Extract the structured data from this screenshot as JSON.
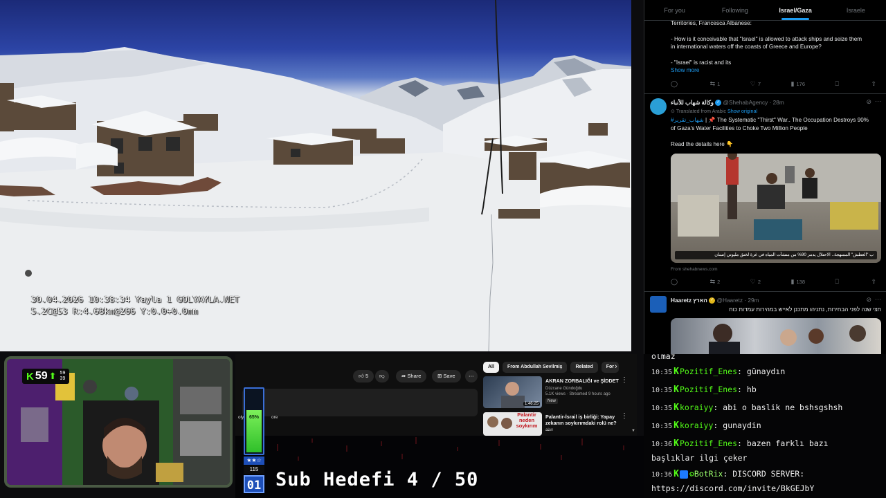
{
  "camera": {
    "osd_line1": "30.04.2026 10:38:34 Yayla 1 GOLYAYLA.NET",
    "osd_line2": "5.2C@53 R:4.68km@266 Y:0.0+0.0mm"
  },
  "twitter": {
    "tabs": [
      "For you",
      "Following",
      "Israel/Gaza",
      "Israele"
    ],
    "active_tab": "Israel/Gaza",
    "post1": {
      "lines": [
        "Territories, Francesca Albanese:",
        "",
        "- How is it conceivable that \"Israel\" is allowed to attack ships and seize them",
        "in international waters off the coasts of Greece and Europe?",
        "",
        "- \"Israel\" is racist and its"
      ],
      "show_more": "Show more",
      "replies": "",
      "reposts": "1",
      "likes": "7",
      "views": "176"
    },
    "post2": {
      "name": "وكالة شهاب للأنباء",
      "handle": "@ShehabAgency",
      "time": "28m",
      "translated": "Translated from Arabic",
      "show_original": "Show original",
      "hashtag": "#شهاب_تقرير",
      "text_after_hashtag": "| 📌 The Systematic \"Thirst\" War.. The Occupation Destroys 90%",
      "text_line2": "of Gaza's Water Facilities to Choke Two Million People",
      "details": "Read the details here 👇",
      "image_caption": "ب \"العطش\" الممنهجة.. الاحتلال يدمر 90% من منشآت المياه في غزة لخنق مليوني إنسان",
      "link_source": "From shehabnews.com",
      "replies": "",
      "reposts": "2",
      "likes": "2",
      "views": "138"
    },
    "post3": {
      "name": "Haaretz הארץ",
      "handle": "@Haaretz",
      "time": "29m",
      "text": "חצי שנה לפני הבחירות, נתניהו מתכנן לאייש במהירות עמדות כוח"
    }
  },
  "chat": {
    "partial_top": "olmaz",
    "messages": [
      {
        "time": "10:35",
        "user": "Pozitif_Enes",
        "text": "günaydın"
      },
      {
        "time": "10:35",
        "user": "Pozitif_Enes",
        "text": "hb"
      },
      {
        "time": "10:35",
        "user": "koraiyy",
        "text": "abi o baslik ne bshsgshsh"
      },
      {
        "time": "10:35",
        "user": "koraiyy",
        "text": "gunaydin"
      },
      {
        "time": "10:36",
        "user": "Pozitif_Enes",
        "text": "bazen farklı bazı"
      },
      {
        "time": "",
        "user": "",
        "text": "başlıklar ilgi çeker"
      },
      {
        "time": "10:36",
        "user": "BotRix",
        "text": "DISCORD SERVER:"
      },
      {
        "time": "",
        "user": "",
        "text": "https://discord.com/invite/BkGEJbY"
      }
    ]
  },
  "youtube": {
    "like_count": "5",
    "share_label": "Share",
    "save_label": "Save",
    "desc_fragment_left": "olya",
    "desc_fragment_more": "ore",
    "chips": [
      "All",
      "From Abdullah Sevilmiş",
      "Related",
      "For"
    ],
    "recs": [
      {
        "title": "AKRAN ZORBALIĞI ve ŞİDDET",
        "channel": "Düzcane Gündoğdu",
        "meta": "5.1K views · Streamed 9 hours ago",
        "badge": "New",
        "duration": "1:46:25"
      },
      {
        "title": "Palantir-İsrail iş birliği: Yapay zekanın soykırımdaki rolü ne? ...",
        "channel": "alan",
        "meta": "",
        "badge": "",
        "duration": "",
        "thumb_text": "Palantir neden soykırım"
      }
    ]
  },
  "stream": {
    "kick_count": "59",
    "side_top": "59",
    "side_bottom": "39",
    "level_percent_label": "65%",
    "level_percent": 65,
    "level_stars": "★★☆",
    "level_points": "115",
    "level_number": "01",
    "sub_goal": "Sub Hedefi 4 / 50"
  },
  "colors": {
    "kick_green": "#53fc18",
    "twitter_blue": "#1d9bf0",
    "level_blue": "#1e4fb8"
  }
}
